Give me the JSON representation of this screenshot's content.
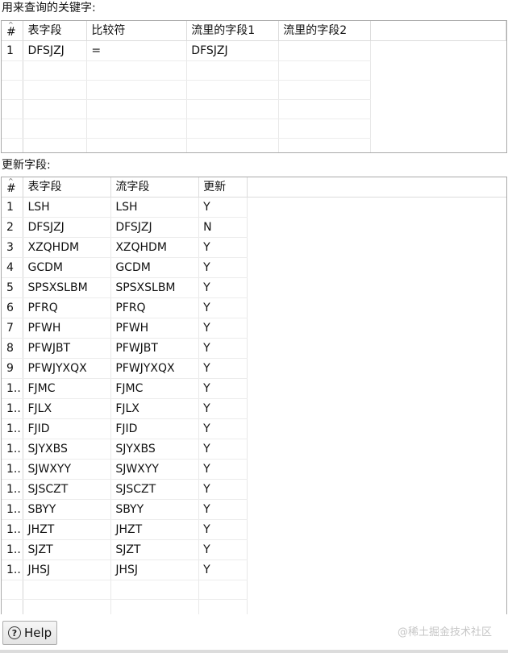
{
  "query_section": {
    "label": "用来查询的关键字:",
    "columns": [
      "#",
      "表字段",
      "比较符",
      "流里的字段1",
      "流里的字段2"
    ],
    "rows": [
      {
        "num": "1",
        "table_field": "DFSJZJ",
        "comparator": "=",
        "stream_field1": "DFSJZJ",
        "stream_field2": ""
      }
    ]
  },
  "update_section": {
    "label": "更新字段:",
    "columns": [
      "#",
      "表字段",
      "流字段",
      "更新"
    ],
    "rows": [
      {
        "num": "1",
        "table_field": "LSH",
        "stream_field": "LSH",
        "update": "Y"
      },
      {
        "num": "2",
        "table_field": "DFSJZJ",
        "stream_field": "DFSJZJ",
        "update": "N"
      },
      {
        "num": "3",
        "table_field": "XZQHDM",
        "stream_field": "XZQHDM",
        "update": "Y"
      },
      {
        "num": "4",
        "table_field": "GCDM",
        "stream_field": "GCDM",
        "update": "Y"
      },
      {
        "num": "5",
        "table_field": "SPSXSLBM",
        "stream_field": "SPSXSLBM",
        "update": "Y"
      },
      {
        "num": "6",
        "table_field": "PFRQ",
        "stream_field": "PFRQ",
        "update": "Y"
      },
      {
        "num": "7",
        "table_field": "PFWH",
        "stream_field": "PFWH",
        "update": "Y"
      },
      {
        "num": "8",
        "table_field": "PFWJBT",
        "stream_field": "PFWJBT",
        "update": "Y"
      },
      {
        "num": "9",
        "table_field": "PFWJYXQX",
        "stream_field": "PFWJYXQX",
        "update": "Y"
      },
      {
        "num": "1..",
        "table_field": "FJMC",
        "stream_field": "FJMC",
        "update": "Y"
      },
      {
        "num": "1..",
        "table_field": "FJLX",
        "stream_field": "FJLX",
        "update": "Y"
      },
      {
        "num": "1..",
        "table_field": "FJID",
        "stream_field": "FJID",
        "update": "Y"
      },
      {
        "num": "1..",
        "table_field": "SJYXBS",
        "stream_field": "SJYXBS",
        "update": "Y"
      },
      {
        "num": "1..",
        "table_field": "SJWXYY",
        "stream_field": "SJWXYY",
        "update": "Y"
      },
      {
        "num": "1..",
        "table_field": "SJSCZT",
        "stream_field": "SJSCZT",
        "update": "Y"
      },
      {
        "num": "1..",
        "table_field": "SBYY",
        "stream_field": "SBYY",
        "update": "Y"
      },
      {
        "num": "1..",
        "table_field": "JHZT",
        "stream_field": "JHZT",
        "update": "Y"
      },
      {
        "num": "1..",
        "table_field": "SJZT",
        "stream_field": "SJZT",
        "update": "Y"
      },
      {
        "num": "1..",
        "table_field": "JHSJ",
        "stream_field": "JHSJ",
        "update": "Y"
      }
    ]
  },
  "footer": {
    "help_label": "Help",
    "help_icon": "question-mark-circle-icon",
    "watermark": "@稀土掘金技术社区"
  }
}
